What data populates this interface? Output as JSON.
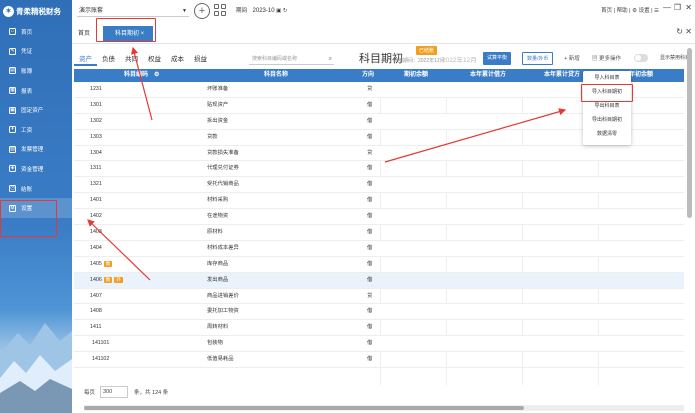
{
  "app": {
    "logo_text": "青柔精税财务"
  },
  "sidebar": {
    "items": [
      {
        "label": "首页",
        "icon": "home-icon",
        "glyph": "⌂"
      },
      {
        "label": "凭证",
        "icon": "voucher-icon",
        "glyph": "✎"
      },
      {
        "label": "账簿",
        "icon": "ledger-icon",
        "glyph": "▤"
      },
      {
        "label": "报表",
        "icon": "report-icon",
        "glyph": "▦"
      },
      {
        "label": "固定资产",
        "icon": "asset-icon",
        "glyph": "▣"
      },
      {
        "label": "工资",
        "icon": "salary-icon",
        "glyph": "¥"
      },
      {
        "label": "发票管理",
        "icon": "invoice-icon",
        "glyph": "▧"
      },
      {
        "label": "资金管理",
        "icon": "fund-icon",
        "glyph": "◈"
      },
      {
        "label": "结账",
        "icon": "close-account-icon",
        "glyph": "◷"
      },
      {
        "label": "设置",
        "icon": "settings-icon",
        "glyph": "⚙"
      }
    ],
    "selected_index": 9
  },
  "topbar": {
    "account_name": "演示账套",
    "period_label": "期间",
    "period_value": "2023-10",
    "links": "首页 | 帮助 | ⚙ 设置 | ☰"
  },
  "tabs": {
    "home": "首页",
    "active": "科目期初 ×"
  },
  "subtabs": [
    "资产",
    "负债",
    "共同",
    "权益",
    "成本",
    "损益"
  ],
  "search": {
    "placeholder": "搜索科目编码或名称"
  },
  "page": {
    "title": "科目期初",
    "subtitle": "启用期间：2022年12月",
    "badge": "已结账",
    "faded_title": "2022年12月",
    "trial_balance_btn": "试算平衡",
    "currency_btn": "数量/外币",
    "add_btn": "+ 新增",
    "more_btn": "更多操作",
    "toggle_label": "显示禁用科目"
  },
  "table": {
    "columns": [
      "科目编码",
      "科目名称",
      "方向",
      "期初余额",
      "本年累计借方",
      "本年累计贷方",
      "年初余额"
    ],
    "rows": [
      {
        "code": "1231",
        "name": "坏账准备",
        "dir": "贷",
        "tags": []
      },
      {
        "code": "1301",
        "name": "贴现资产",
        "dir": "借",
        "tags": []
      },
      {
        "code": "1302",
        "name": "拆出资金",
        "dir": "借",
        "tags": []
      },
      {
        "code": "1303",
        "name": "贷款",
        "dir": "借",
        "tags": []
      },
      {
        "code": "1304",
        "name": "贷款损失准备",
        "dir": "贷",
        "tags": []
      },
      {
        "code": "1311",
        "name": "代理兑付证券",
        "dir": "借",
        "tags": []
      },
      {
        "code": "1321",
        "name": "受托代销商品",
        "dir": "借",
        "tags": []
      },
      {
        "code": "1401",
        "name": "材料采购",
        "dir": "借",
        "tags": []
      },
      {
        "code": "1402",
        "name": "在途物资",
        "dir": "借",
        "tags": []
      },
      {
        "code": "1403",
        "name": "原材料",
        "dir": "借",
        "tags": []
      },
      {
        "code": "1404",
        "name": "材料成本差异",
        "dir": "借",
        "tags": []
      },
      {
        "code": "1405",
        "name": "库存商品",
        "dir": "借",
        "tags": [
          "数"
        ]
      },
      {
        "code": "1406",
        "name": "发出商品",
        "dir": "借",
        "tags": [
          "数",
          "外"
        ]
      },
      {
        "code": "1407",
        "name": "商品进销差价",
        "dir": "贷",
        "tags": []
      },
      {
        "code": "1408",
        "name": "委托加工物资",
        "dir": "借",
        "tags": []
      },
      {
        "code": "1411",
        "name": "周转材料",
        "dir": "借",
        "tags": []
      },
      {
        "code": "141101",
        "name": "包装物",
        "dir": "借",
        "tags": []
      },
      {
        "code": "141102",
        "name": "低值易耗品",
        "dir": "借",
        "tags": []
      }
    ],
    "highlight_row": 12
  },
  "dropdown": [
    "导入科目表",
    "导入科目期初",
    "导出科目表",
    "导出科目期初",
    "数据清零"
  ],
  "footer": {
    "per_page_label": "每页",
    "per_page": "300",
    "total": "条，共 124 条"
  },
  "colors": {
    "primary": "#3a7dc6",
    "annotation": "#e53935",
    "tag": "#f0a020"
  }
}
